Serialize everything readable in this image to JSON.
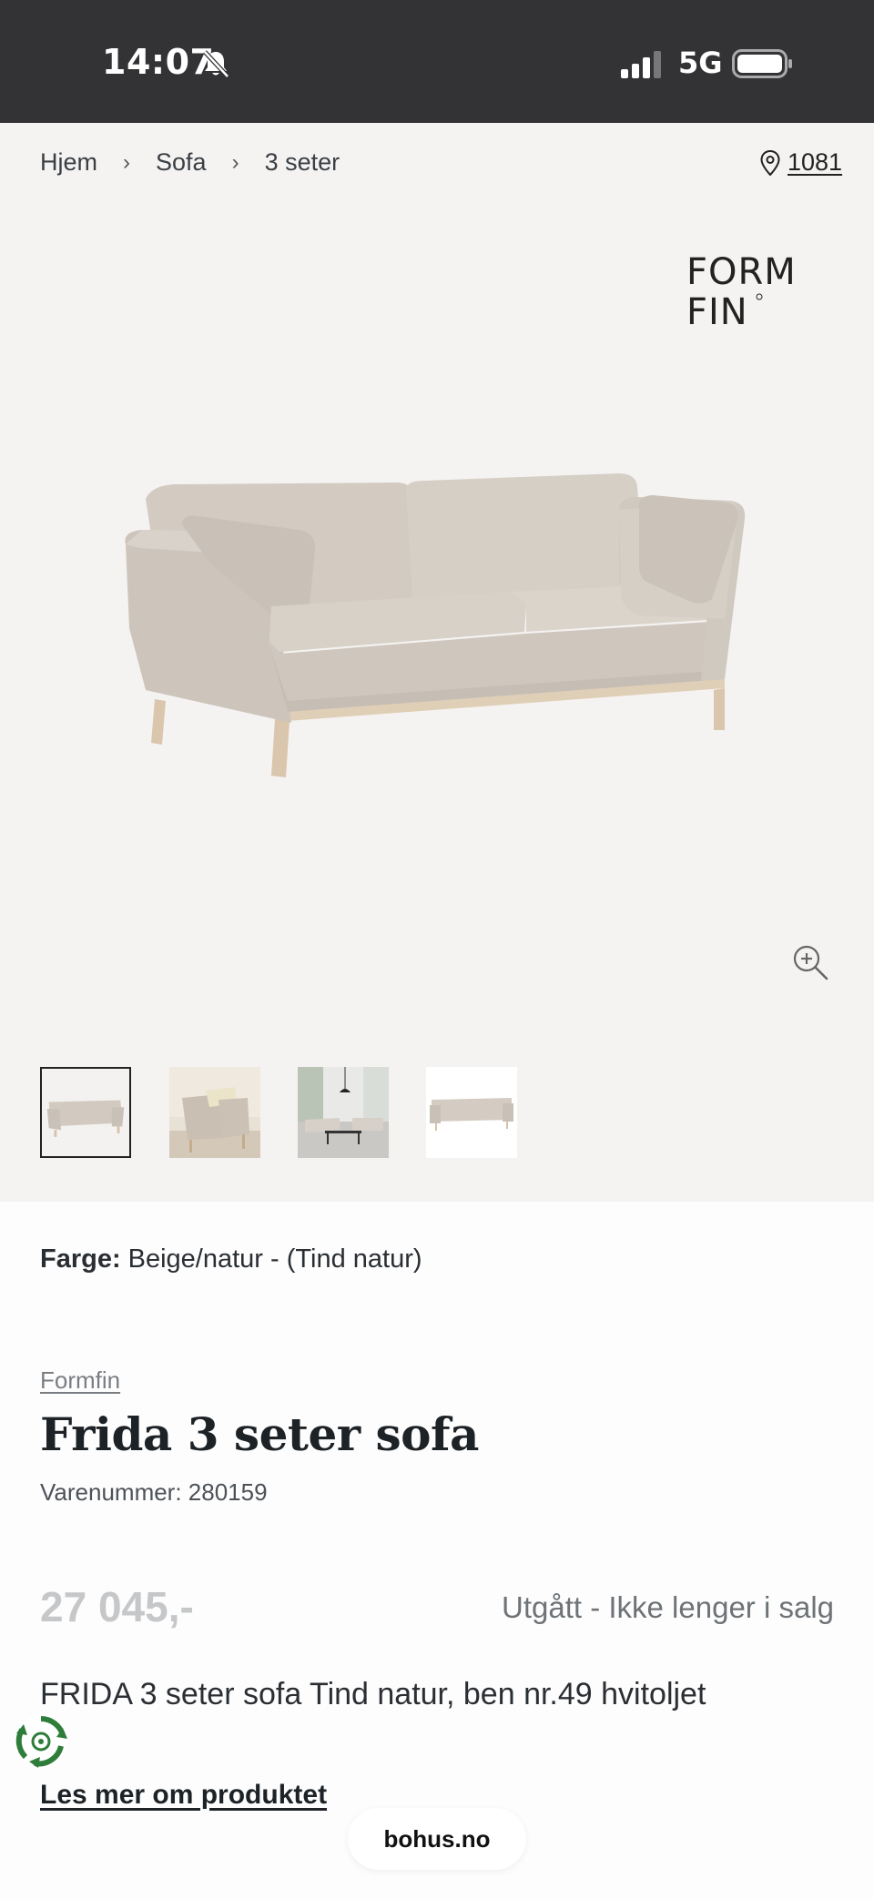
{
  "status_bar": {
    "time": "14:07",
    "network": "5G",
    "icons": [
      "bell-muted-icon",
      "signal-icon",
      "battery-icon"
    ]
  },
  "breadcrumb": {
    "items": [
      "Hjem",
      "Sofa",
      "3 seter"
    ],
    "separator_icon": "chevron-right-icon"
  },
  "location": {
    "icon": "location-pin-icon",
    "code": "1081"
  },
  "brand_logo": {
    "line1": "FORM",
    "line2": "FIN"
  },
  "gallery": {
    "zoom_icon": "zoom-in-icon",
    "thumbnails": [
      "sofa-front",
      "sofa-armchair-interior",
      "living-room",
      "sofa-side"
    ],
    "active_thumbnail": 1
  },
  "product": {
    "color_label": "Farge:",
    "color_value": "Beige/natur - (Tind natur)",
    "brand": "Formfin",
    "title": "Frida 3 seter sofa",
    "sku": "Varenummer: 280159",
    "price": "27 045,-",
    "availability": "Utgått - Ikke lenger i salg",
    "description": "FRIDA 3 seter sofa Tind natur, ben nr.49 hvitoljet",
    "read_more": "Les mer om produktet"
  },
  "browser": {
    "url": "bohus.no"
  },
  "colors": {
    "status_bar_bg": "#333336",
    "gallery_bg": "#f5f3f2",
    "sofa_fabric": "#d7d0c8",
    "price_disabled": "#c5c7c9",
    "eco_green": "#2e7d3a"
  }
}
